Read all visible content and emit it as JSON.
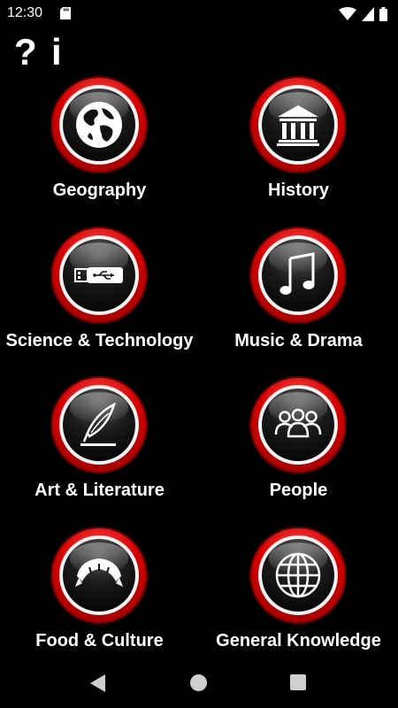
{
  "status_bar": {
    "time": "12:30"
  },
  "header": {
    "help_label": "?",
    "info_label": "i"
  },
  "categories": [
    {
      "label": "Geography",
      "icon": "globe-icon"
    },
    {
      "label": "History",
      "icon": "museum-icon"
    },
    {
      "label": "Science & Technology",
      "icon": "usb-drive-icon"
    },
    {
      "label": "Music & Drama",
      "icon": "music-note-icon"
    },
    {
      "label": "Art & Literature",
      "icon": "quill-pen-icon"
    },
    {
      "label": "People",
      "icon": "people-group-icon"
    },
    {
      "label": "Food & Culture",
      "icon": "croissant-icon"
    },
    {
      "label": "General Knowledge",
      "icon": "world-grid-icon"
    }
  ],
  "colors": {
    "background": "#000000",
    "button_red": "#d40000",
    "text": "#ffffff"
  }
}
